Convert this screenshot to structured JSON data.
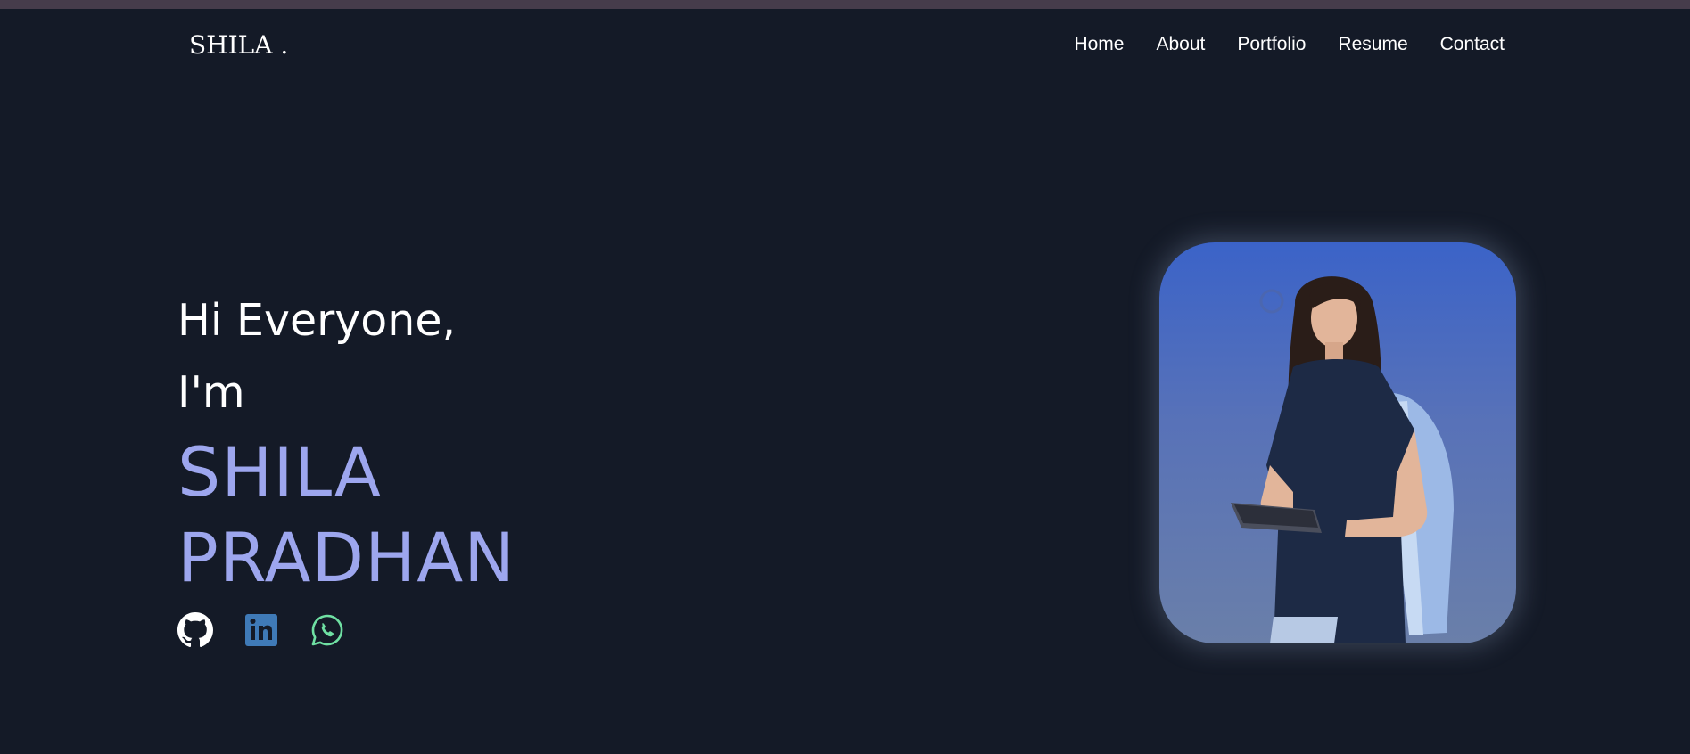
{
  "brand": {
    "logo": "SHILA ."
  },
  "nav": {
    "items": [
      {
        "label": "Home"
      },
      {
        "label": "About"
      },
      {
        "label": "Portfolio"
      },
      {
        "label": "Resume"
      },
      {
        "label": "Contact"
      }
    ]
  },
  "hero": {
    "greeting": "Hi Everyone,",
    "intro": "I'm",
    "name_first": "SHILA",
    "name_last": "PRADHAN",
    "name_color": "#9da6ee"
  },
  "socials": [
    {
      "icon": "github-icon",
      "color": "#ffffff"
    },
    {
      "icon": "linkedin-icon",
      "color": "#3f7ab7"
    },
    {
      "icon": "whatsapp-icon",
      "color": "#6fe0a3"
    }
  ],
  "colors": {
    "background": "#141a27",
    "top_strip": "#463c4b",
    "photo_gradient_top": "#3b63c8",
    "photo_gradient_bottom": "#6a7fa9"
  }
}
